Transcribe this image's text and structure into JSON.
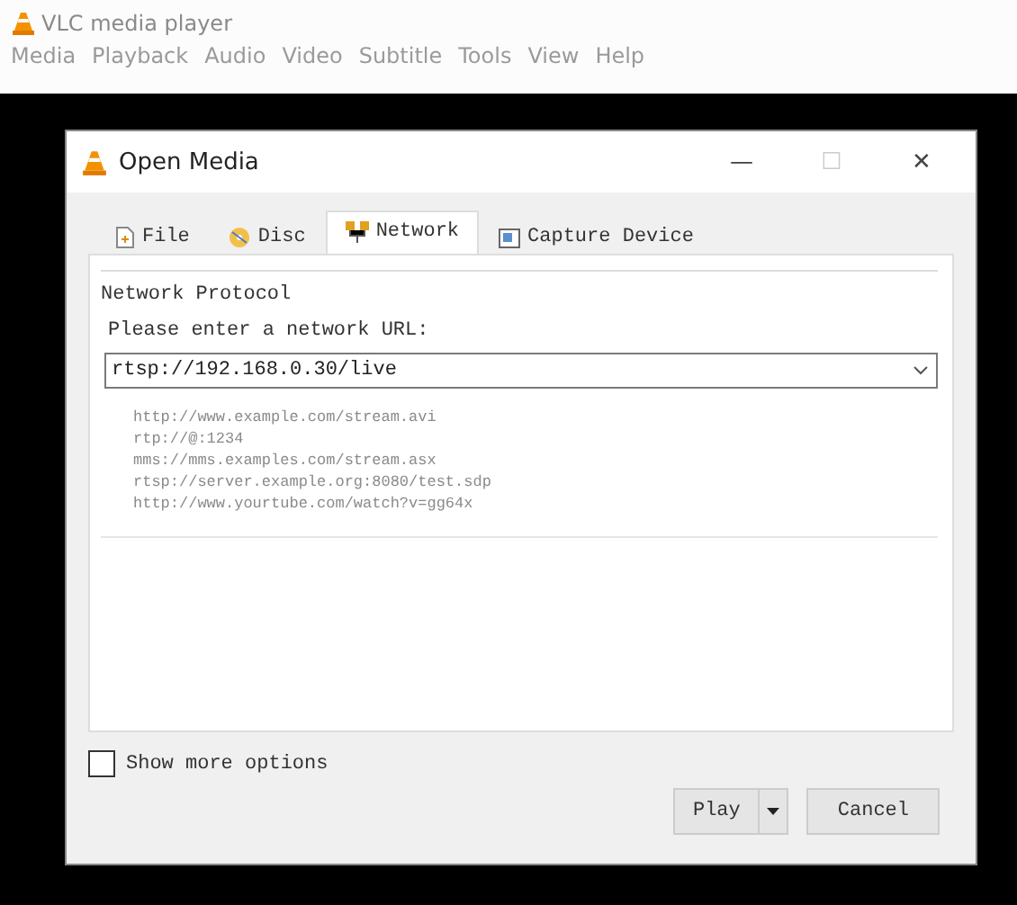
{
  "window": {
    "title": "VLC media player"
  },
  "menu": [
    "Media",
    "Playback",
    "Audio",
    "Video",
    "Subtitle",
    "Tools",
    "View",
    "Help"
  ],
  "dialog": {
    "title": "Open Media",
    "controls": [
      "—",
      "☐",
      "✕"
    ],
    "tabs": [
      {
        "label": "File",
        "selected": false
      },
      {
        "label": "Disc",
        "selected": false
      },
      {
        "label": "Network",
        "selected": true
      },
      {
        "label": "Capture Device",
        "selected": false
      }
    ],
    "group_title": "Network Protocol",
    "url_label": "Please enter a network URL:",
    "url_value": "rtsp://192.168.0.30/live",
    "examples": [
      "http://www.example.com/stream.avi",
      "rtp://@:1234",
      "mms://mms.examples.com/stream.asx",
      "rtsp://server.example.org:8080/test.sdp",
      "http://www.yourtube.com/watch?v=gg64x"
    ],
    "show_more": {
      "label": "Show more options",
      "checked": false
    },
    "buttons": {
      "play": "Play",
      "cancel": "Cancel"
    }
  }
}
